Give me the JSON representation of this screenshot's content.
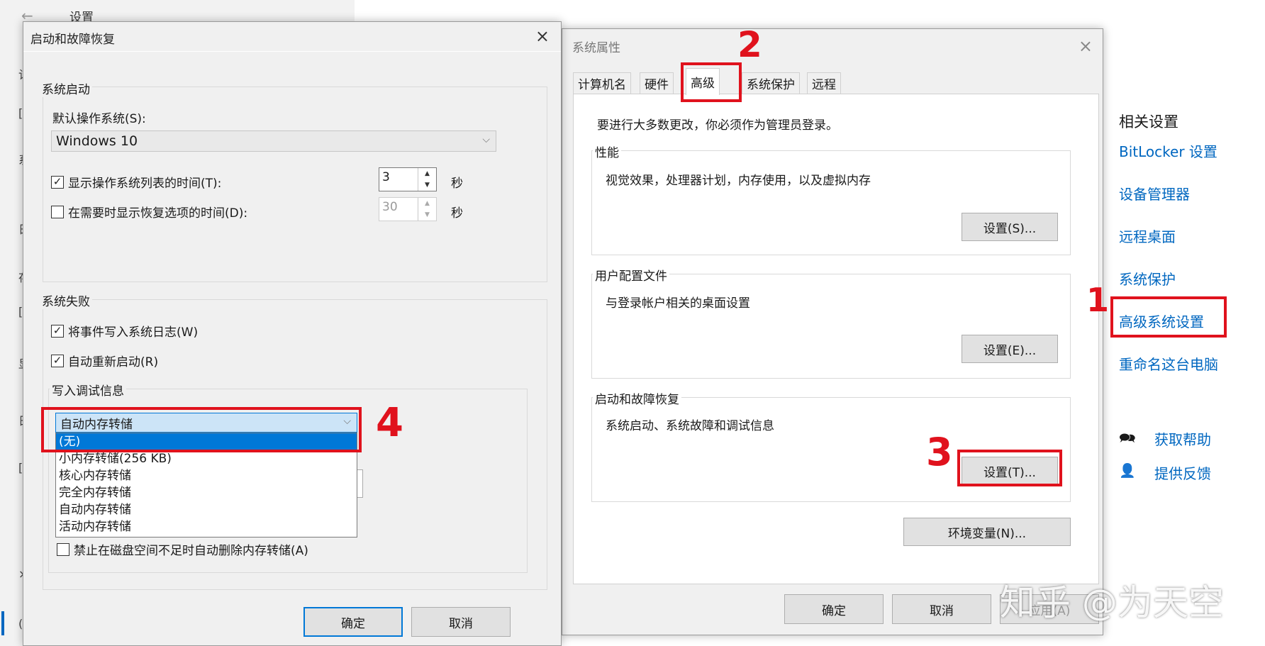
{
  "background_window": {
    "back_icon": "←",
    "title": "设置",
    "strip_glyphs": [
      "计",
      "[",
      "系",
      "日",
      "存",
      "[",
      "显",
      "日",
      "[",
      "×",
      "("
    ]
  },
  "startup_dialog": {
    "title": "启动和故障恢复",
    "close_icon": "×",
    "system_startup": {
      "group_label": "系统启动",
      "default_os_label": "默认操作系统(S):",
      "default_os_value": "Windows 10",
      "show_os_list": {
        "checked": true,
        "label": "显示操作系统列表的时间(T):",
        "value": "3",
        "unit": "秒"
      },
      "show_recovery": {
        "checked": false,
        "label": "在需要时显示恢复选项的时间(D):",
        "value": "30",
        "unit": "秒"
      }
    },
    "system_failure": {
      "group_label": "系统失败",
      "write_event": {
        "checked": true,
        "label": "将事件写入系统日志(W)"
      },
      "auto_restart": {
        "checked": true,
        "label": "自动重新启动(R)"
      },
      "debug_group_label": "写入调试信息",
      "dump_selected": "自动内存转储",
      "dump_options": [
        "(无)",
        "小内存转储(256 KB)",
        "核心内存转储",
        "完全内存转储",
        "自动内存转储",
        "活动内存转储"
      ],
      "dump_highlighted": "(无)",
      "disable_auto_delete": {
        "checked": false,
        "label": "禁止在磁盘空间不足时自动删除内存转储(A)"
      }
    },
    "ok_label": "确定",
    "cancel_label": "取消"
  },
  "system_properties": {
    "title": "系统属性",
    "close_icon": "×",
    "tabs": [
      "计算机名",
      "硬件",
      "高级",
      "系统保护",
      "远程"
    ],
    "active_tab": "高级",
    "admin_note": "要进行大多数更改，你必须作为管理员登录。",
    "performance": {
      "group_label": "性能",
      "desc": "视觉效果，处理器计划，内存使用，以及虚拟内存",
      "button": "设置(S)..."
    },
    "user_profiles": {
      "group_label": "用户配置文件",
      "desc": "与登录帐户相关的桌面设置",
      "button": "设置(E)..."
    },
    "startup_recovery": {
      "group_label": "启动和故障恢复",
      "desc": "系统启动、系统故障和调试信息",
      "button": "设置(T)..."
    },
    "env_button": "环境变量(N)...",
    "ok_label": "确定",
    "cancel_label": "取消",
    "apply_label": "应用(A)"
  },
  "related_settings": {
    "heading": "相关设置",
    "links": [
      "BitLocker 设置",
      "设备管理器",
      "远程桌面",
      "系统保护",
      "高级系统设置",
      "重命名这台电脑"
    ],
    "help_label": "获取帮助",
    "feedback_label": "提供反馈"
  },
  "annotations": [
    "1",
    "2",
    "3",
    "4"
  ],
  "watermark": "知乎 @为天空",
  "colors": {
    "annotation_red": "#e0121d",
    "link_blue": "#0067c0",
    "selection_blue": "#0078d7"
  }
}
